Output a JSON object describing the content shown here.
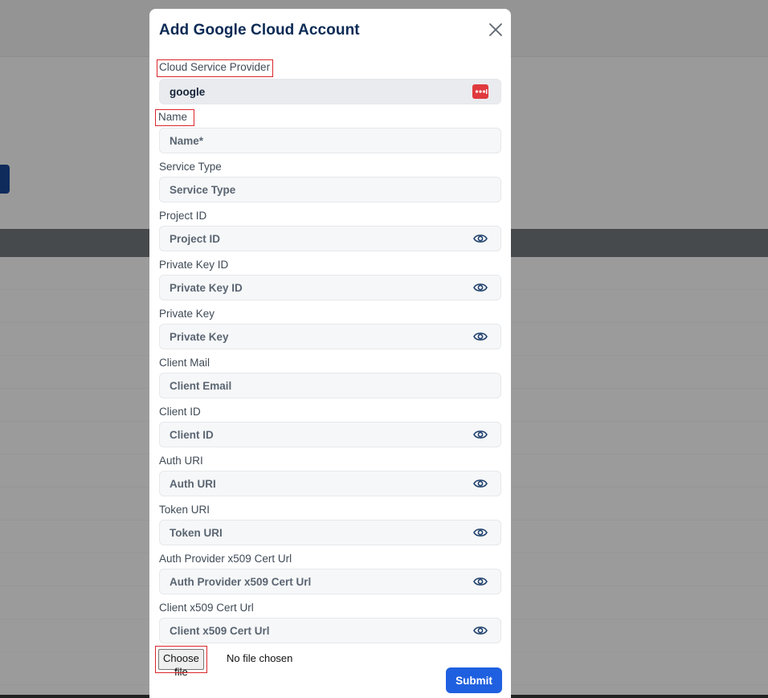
{
  "modal": {
    "title": "Add Google Cloud Account",
    "close_icon": "close-icon"
  },
  "fields": {
    "provider": {
      "label": "Cloud Service Provider",
      "value": "google",
      "badge_icon": "more-dots-icon"
    },
    "name": {
      "label": "Name",
      "placeholder": "Name*"
    },
    "service_type": {
      "label": "Service Type",
      "placeholder": "Service Type"
    },
    "project_id": {
      "label": "Project ID",
      "placeholder": "Project ID",
      "icon": "eye-icon"
    },
    "private_key_id": {
      "label": "Private Key ID",
      "placeholder": "Private Key ID",
      "icon": "eye-icon"
    },
    "private_key": {
      "label": "Private Key",
      "placeholder": "Private Key",
      "icon": "eye-icon"
    },
    "client_mail": {
      "label": "Client Mail",
      "placeholder": "Client Email"
    },
    "client_id": {
      "label": "Client ID",
      "placeholder": "Client ID",
      "icon": "eye-icon"
    },
    "auth_uri": {
      "label": "Auth URI",
      "placeholder": "Auth URI",
      "icon": "eye-icon"
    },
    "token_uri": {
      "label": "Token URI",
      "placeholder": "Token URI",
      "icon": "eye-icon"
    },
    "auth_provider_cert": {
      "label": "Auth Provider x509 Cert Url",
      "placeholder": "Auth Provider x509 Cert Url",
      "icon": "eye-icon"
    },
    "client_cert": {
      "label": "Client x509 Cert Url",
      "placeholder": "Client x509 Cert Url",
      "icon": "eye-icon"
    }
  },
  "file_input": {
    "button_label": "Choose file",
    "status": "No file chosen"
  },
  "actions": {
    "submit_label": "Submit"
  },
  "colors": {
    "title": "#0b2a55",
    "submit": "#1f60e0",
    "highlight_outline": "#d9262b",
    "badge": "#e03a3e"
  }
}
